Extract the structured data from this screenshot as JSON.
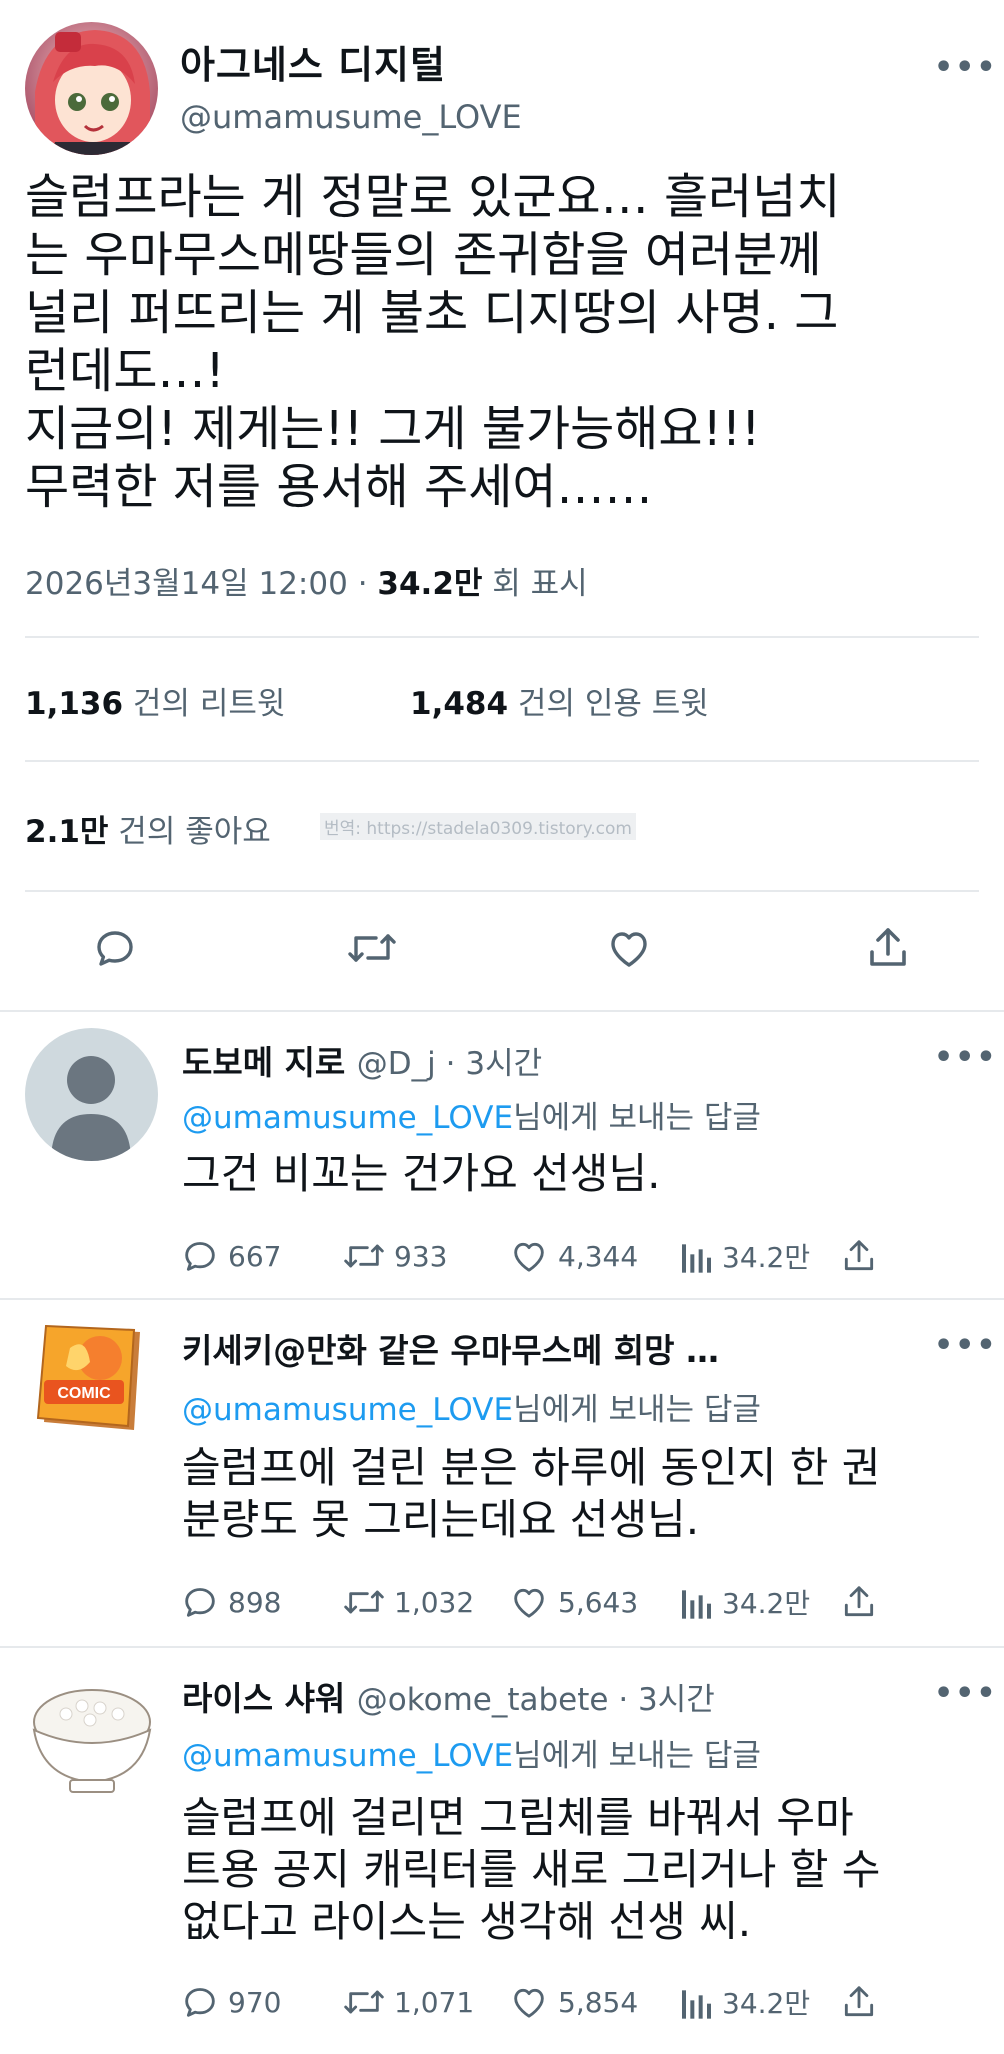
{
  "tweet": {
    "author_name": "아그네스 디지털",
    "author_handle": "@umamusume_LOVE",
    "more_label": "•••",
    "text": "슬럼프라는 게 정말로 있군요… 흘러넘치\n는 우마무스메땅들의 존귀함을 여러분께\n널리 퍼뜨리는 게 불초 디지땅의 사명. 그\n런데도…!\n지금의! 제게는!! 그게 불가능해요!!!\n무력한 저를 용서해 주세여……",
    "date": "2026년3월14일 12:00",
    "separator": "·",
    "views": "34.2만",
    "views_label": "회 표시",
    "retweets": "1,136",
    "retweets_label": "건의 리트윗",
    "quotes": "1,484",
    "quotes_label": "건의 인용 트윗",
    "likes": "2.1만",
    "likes_label": "건의 좋아요",
    "watermark": "번역: https://stadela0309.tistory.com"
  },
  "actions": {
    "reply_icon": "reply-icon",
    "retweet_icon": "retweet-icon",
    "like_icon": "like-icon",
    "share_icon": "share-icon"
  },
  "replies": [
    {
      "name": "도보메 지로",
      "handle": "@D_j · 3시간",
      "to_user": "@umamusume_LOVE",
      "to_suffix": "님에게 보내는 답글",
      "text": "그건 비꼬는 건가요 선생님.",
      "reply_count": "667",
      "retweet_count": "933",
      "like_count": "4,344",
      "view_count": "34.2만"
    },
    {
      "name": "키세키@만화 같은 우마무스메 희망 …",
      "handle": "",
      "to_user": "@umamusume_LOVE",
      "to_suffix": "님에게 보내는 답글",
      "text": "슬럼프에 걸린 분은 하루에 동인지 한 권\n분량도 못 그리는데요 선생님.",
      "reply_count": "898",
      "retweet_count": "1,032",
      "like_count": "5,643",
      "view_count": "34.2만"
    },
    {
      "name": "라이스 샤워",
      "handle": "@okome_tabete · 3시간",
      "to_user": "@umamusume_LOVE",
      "to_suffix": "님에게 보내는 답글",
      "text": "슬럼프에 걸리면 그림체를 바꿔서 우마\n트용 공지 캐릭터를 새로 그리거나 할 수\n없다고 라이스는 생각해 선생 씨.",
      "reply_count": "970",
      "retweet_count": "1,071",
      "like_count": "5,854",
      "view_count": "34.2만"
    }
  ],
  "comic_badge": "COMIC",
  "colors": {
    "link": "#1d9bf0",
    "secondary": "#536471",
    "divider": "#e6e9ec"
  }
}
